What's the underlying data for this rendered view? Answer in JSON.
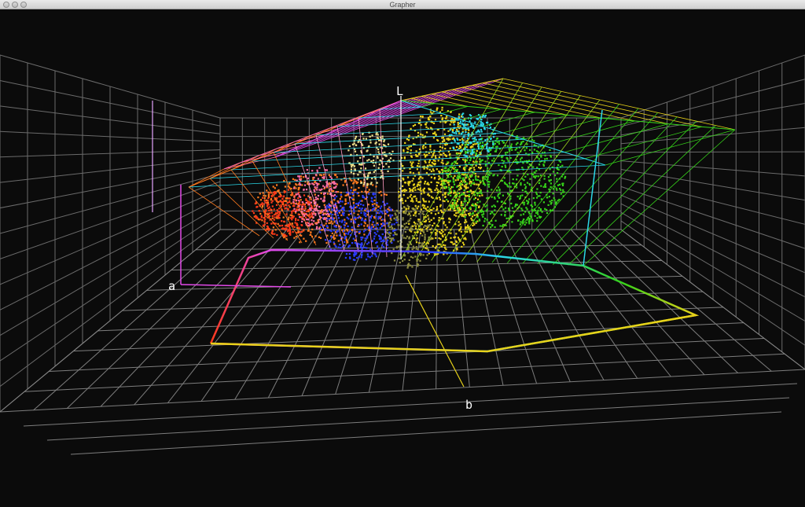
{
  "window": {
    "title": "Grapher"
  },
  "plot": {
    "axis_labels": {
      "vertical": "L",
      "horizontal_left": "a",
      "horizontal_front": "b"
    },
    "colors": {
      "background": "#0b0b0b",
      "grid": "#777777",
      "red": "#ff3a1a",
      "orange": "#ff7a1e",
      "yellow": "#e8d21a",
      "green": "#36d21a",
      "cyan": "#2bd8e8",
      "blue": "#2b3cff",
      "magenta": "#e24ae8",
      "pink": "#ff6ea8"
    }
  }
}
